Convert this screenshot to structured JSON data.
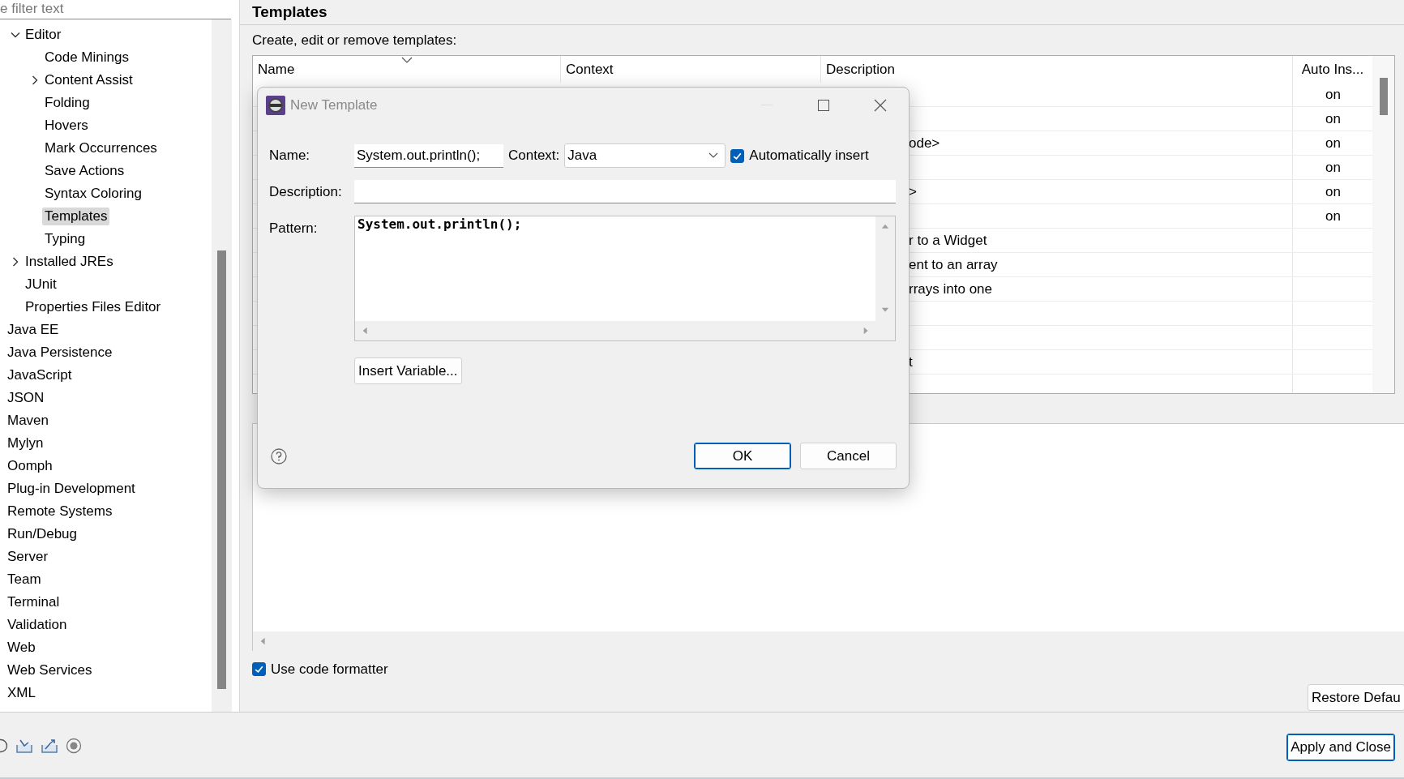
{
  "filter": {
    "placeholder": "e filter text"
  },
  "tree": {
    "continued_children": [
      {
        "label": "Editor",
        "expanded": true,
        "selected": false,
        "children": [
          {
            "label": "Code Minings",
            "selected": false
          },
          {
            "label": "Content Assist",
            "expanded": false,
            "selected": false
          },
          {
            "label": "Folding",
            "selected": false
          },
          {
            "label": "Hovers",
            "selected": false
          },
          {
            "label": "Mark Occurrences",
            "selected": false
          },
          {
            "label": "Save Actions",
            "selected": false
          },
          {
            "label": "Syntax Coloring",
            "selected": false
          },
          {
            "label": "Templates",
            "selected": true
          },
          {
            "label": "Typing",
            "selected": false
          }
        ]
      },
      {
        "label": "Installed JREs",
        "expanded": false,
        "selected": false
      },
      {
        "label": "JUnit",
        "selected": false
      },
      {
        "label": "Properties Files Editor",
        "selected": false
      }
    ],
    "items": [
      {
        "label": "Java EE",
        "selected": false
      },
      {
        "label": "Java Persistence",
        "selected": false
      },
      {
        "label": "JavaScript",
        "selected": false
      },
      {
        "label": "JSON",
        "selected": false
      },
      {
        "label": "Maven",
        "selected": false
      },
      {
        "label": "Mylyn",
        "selected": false
      },
      {
        "label": "Oomph",
        "selected": false
      },
      {
        "label": "Plug-in Development",
        "selected": false
      },
      {
        "label": "Remote Systems",
        "selected": false
      },
      {
        "label": "Run/Debug",
        "selected": false
      },
      {
        "label": "Server",
        "selected": false
      },
      {
        "label": "Team",
        "selected": false
      },
      {
        "label": "Terminal",
        "selected": false
      },
      {
        "label": "Validation",
        "selected": false
      },
      {
        "label": "Web",
        "selected": false
      },
      {
        "label": "Web Services",
        "selected": false
      },
      {
        "label": "XML",
        "selected": false
      }
    ]
  },
  "page": {
    "title": "Templates",
    "intro": "Create, edit or remove templates:"
  },
  "table": {
    "columns": [
      "Name",
      "Context",
      "Description",
      "Auto Ins..."
    ],
    "rows": [
      {
        "auto": "on"
      },
      {
        "auto": "on"
      },
      {
        "description": "ode>",
        "auto": "on"
      },
      {
        "auto": "on"
      },
      {
        "description": ">",
        "auto": "on"
      },
      {
        "auto": "on"
      },
      {
        "description": "r to a Widget"
      },
      {
        "description": "ent to an array"
      },
      {
        "description": "rrays into one"
      },
      {},
      {},
      {
        "description": "t"
      },
      {}
    ]
  },
  "use_code_formatter": {
    "label": "Use code formatter",
    "checked": true
  },
  "restore_button": "Restore Defau",
  "apply_button": "Apply and Close",
  "dialog": {
    "title": "New Template",
    "name_label": "Name:",
    "name_value": "System.out.println();",
    "context_label": "Context:",
    "context_value": "Java",
    "auto_insert": {
      "label": "Automatically insert",
      "checked": true
    },
    "description_label": "Description:",
    "pattern_label": "Pattern:",
    "pattern_value": "System.out.println();",
    "insert_variable": "Insert Variable...",
    "ok": "OK",
    "cancel": "Cancel"
  }
}
